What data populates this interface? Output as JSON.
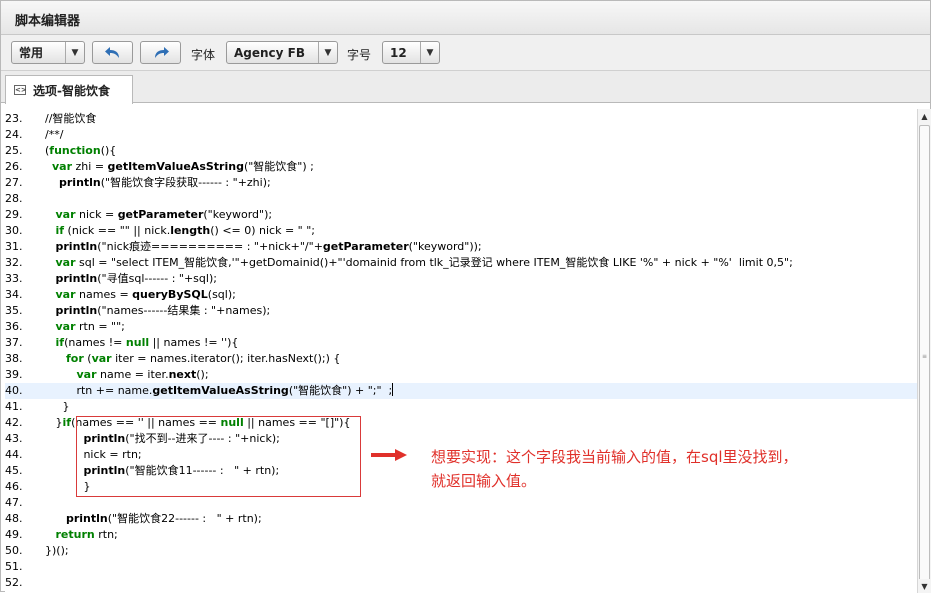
{
  "window": {
    "title": "脚本编辑器"
  },
  "toolbar": {
    "mode_select": "常用",
    "font_label": "字体",
    "font_select": "Agency FB",
    "size_label": "字号",
    "size_select": "12",
    "undo_icon": "undo-icon",
    "redo_icon": "redo-icon"
  },
  "tab": {
    "label": "选项-智能饮食",
    "icon": "code-file-icon"
  },
  "editor": {
    "current_line": "40.",
    "lines": [
      {
        "n": "23.",
        "html": "//智能饮食"
      },
      {
        "n": "24.",
        "html": "/**/"
      },
      {
        "n": "25.",
        "html": "(<span class=\"kw\">function</span>(){"
      },
      {
        "n": "26.",
        "html": "  <span class=\"kw\">var</span> zhi = <span class=\"fn\">getItemValueAsString</span>(\"智能饮食\") ;"
      },
      {
        "n": "27.",
        "html": "    <span class=\"fn\">println</span>(\"智能饮食字段获取------ : \"+zhi);"
      },
      {
        "n": "28.",
        "html": ""
      },
      {
        "n": "29.",
        "html": "   <span class=\"kw\">var</span> nick = <span class=\"fn\">getParameter</span>(\"keyword\");"
      },
      {
        "n": "30.",
        "html": "   <span class=\"kw\">if</span> (nick == \"\" || nick.<span class=\"fn\">length</span>() &lt;= 0) nick = \" \";"
      },
      {
        "n": "31.",
        "html": "   <span class=\"fn\">println</span>(\"nick痕迹========== : \"+nick+\"/\"+<span class=\"fn\">getParameter</span>(\"keyword\"));"
      },
      {
        "n": "32.",
        "html": "   <span class=\"kw\">var</span> sql = \"select ITEM_智能饮食,'\"+getDomainid()+\"'domainid from tlk_记录登记 where ITEM_智能饮食 LIKE '%\" + nick + \"%'  limit 0,5\";"
      },
      {
        "n": "33.",
        "html": "   <span class=\"fn\">println</span>(\"寻值sql------ : \"+sql);"
      },
      {
        "n": "34.",
        "html": "   <span class=\"kw\">var</span> names = <span class=\"fn\">queryBySQL</span>(sql);"
      },
      {
        "n": "35.",
        "html": "   <span class=\"fn\">println</span>(\"names------结果集 : \"+names);"
      },
      {
        "n": "36.",
        "html": "   <span class=\"kw\">var</span> rtn = \"\";"
      },
      {
        "n": "37.",
        "html": "   <span class=\"kw\">if</span>(names != <span class=\"kw\">null</span> || names != ''){"
      },
      {
        "n": "38.",
        "html": "      <span class=\"kw\">for</span> (<span class=\"kw\">var</span> iter = names.iterator(); iter.hasNext();) {"
      },
      {
        "n": "39.",
        "html": "         <span class=\"kw\">var</span> name = iter.<span class=\"fn\">next</span>();"
      },
      {
        "n": "40.",
        "html": "         rtn += name.<span class=\"fn\">getItemValueAsString</span>(\"智能饮食\") + \";\"  ;<span class=\"caret\"></span>"
      },
      {
        "n": "41.",
        "html": "     }"
      },
      {
        "n": "42.",
        "html": "   }<span class=\"kw\">if</span>(names == '' || names == <span class=\"kw\">null</span> || names == \"[]\"){"
      },
      {
        "n": "43.",
        "html": "           <span class=\"fn\">println</span>(\"找不到--进来了---- : \"+nick);"
      },
      {
        "n": "44.",
        "html": "           nick = rtn;"
      },
      {
        "n": "45.",
        "html": "           <span class=\"fn\">println</span>(\"智能饮食11------ :   \" + rtn);"
      },
      {
        "n": "46.",
        "html": "           }"
      },
      {
        "n": "47.",
        "html": ""
      },
      {
        "n": "48.",
        "html": "      <span class=\"fn\">println</span>(\"智能饮食22------ :   \" + rtn);"
      },
      {
        "n": "49.",
        "html": "   <span class=\"kw\">return</span> rtn;"
      },
      {
        "n": "50.",
        "html": "})();"
      },
      {
        "n": "51.",
        "html": ""
      },
      {
        "n": "52.",
        "html": ""
      }
    ]
  },
  "annotation": {
    "line1": "想要实现：这个字段我当前输入的值，在sql里没找到，",
    "line2": "就返回输入值。",
    "color": "#e0302a"
  }
}
